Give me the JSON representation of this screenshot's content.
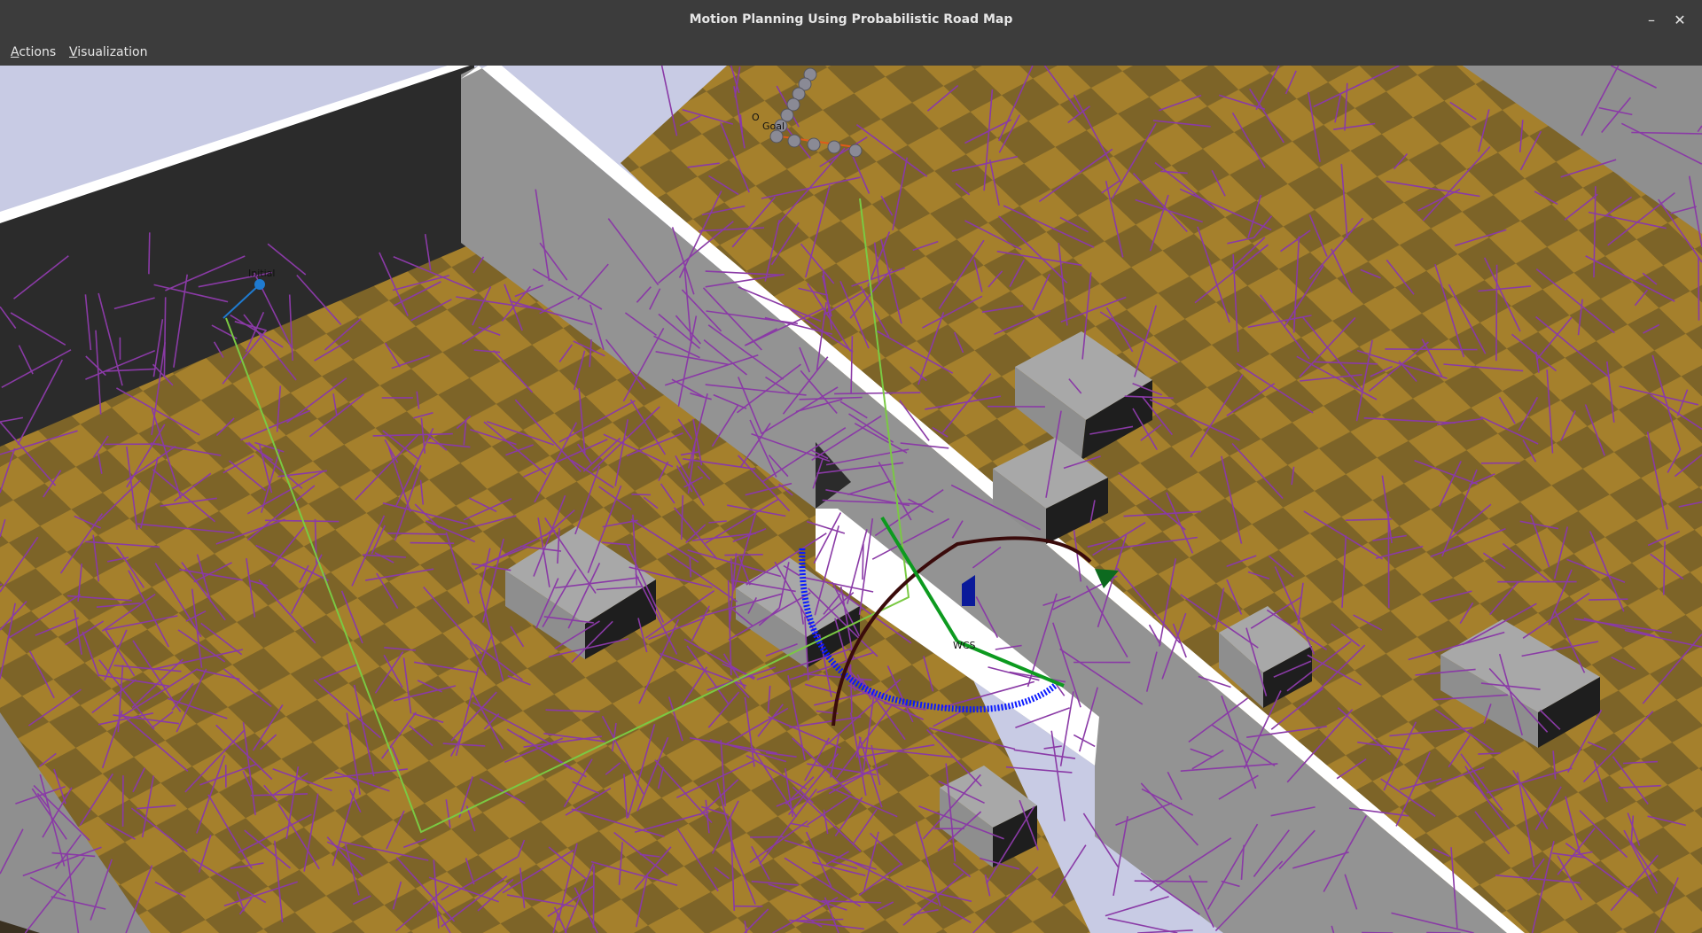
{
  "window": {
    "title": "Motion Planning Using Probabilistic Road Map",
    "minimize_glyph": "–",
    "close_glyph": "✕"
  },
  "menubar": {
    "items": [
      {
        "accel": "A",
        "rest": "ctions",
        "label": "Actions"
      },
      {
        "accel": "V",
        "rest": "isualization",
        "label": "Visualization"
      }
    ]
  },
  "scene": {
    "labels": {
      "initial": "Initial",
      "goal": "Goal",
      "origin": "O",
      "wcs": "WCS"
    },
    "colors": {
      "floor_light": "#a5802c",
      "floor_dark": "#7d6428",
      "wall_dark": "#2b2b2b",
      "partition": "#939393",
      "partition_top": "#ffffff",
      "roadmap_edges": "#8a3aa6",
      "path": "#7ac943",
      "initial_marker": "#1f7bd0",
      "goal_arm": "#8a8a95",
      "sky": "#c8cbe4"
    }
  }
}
